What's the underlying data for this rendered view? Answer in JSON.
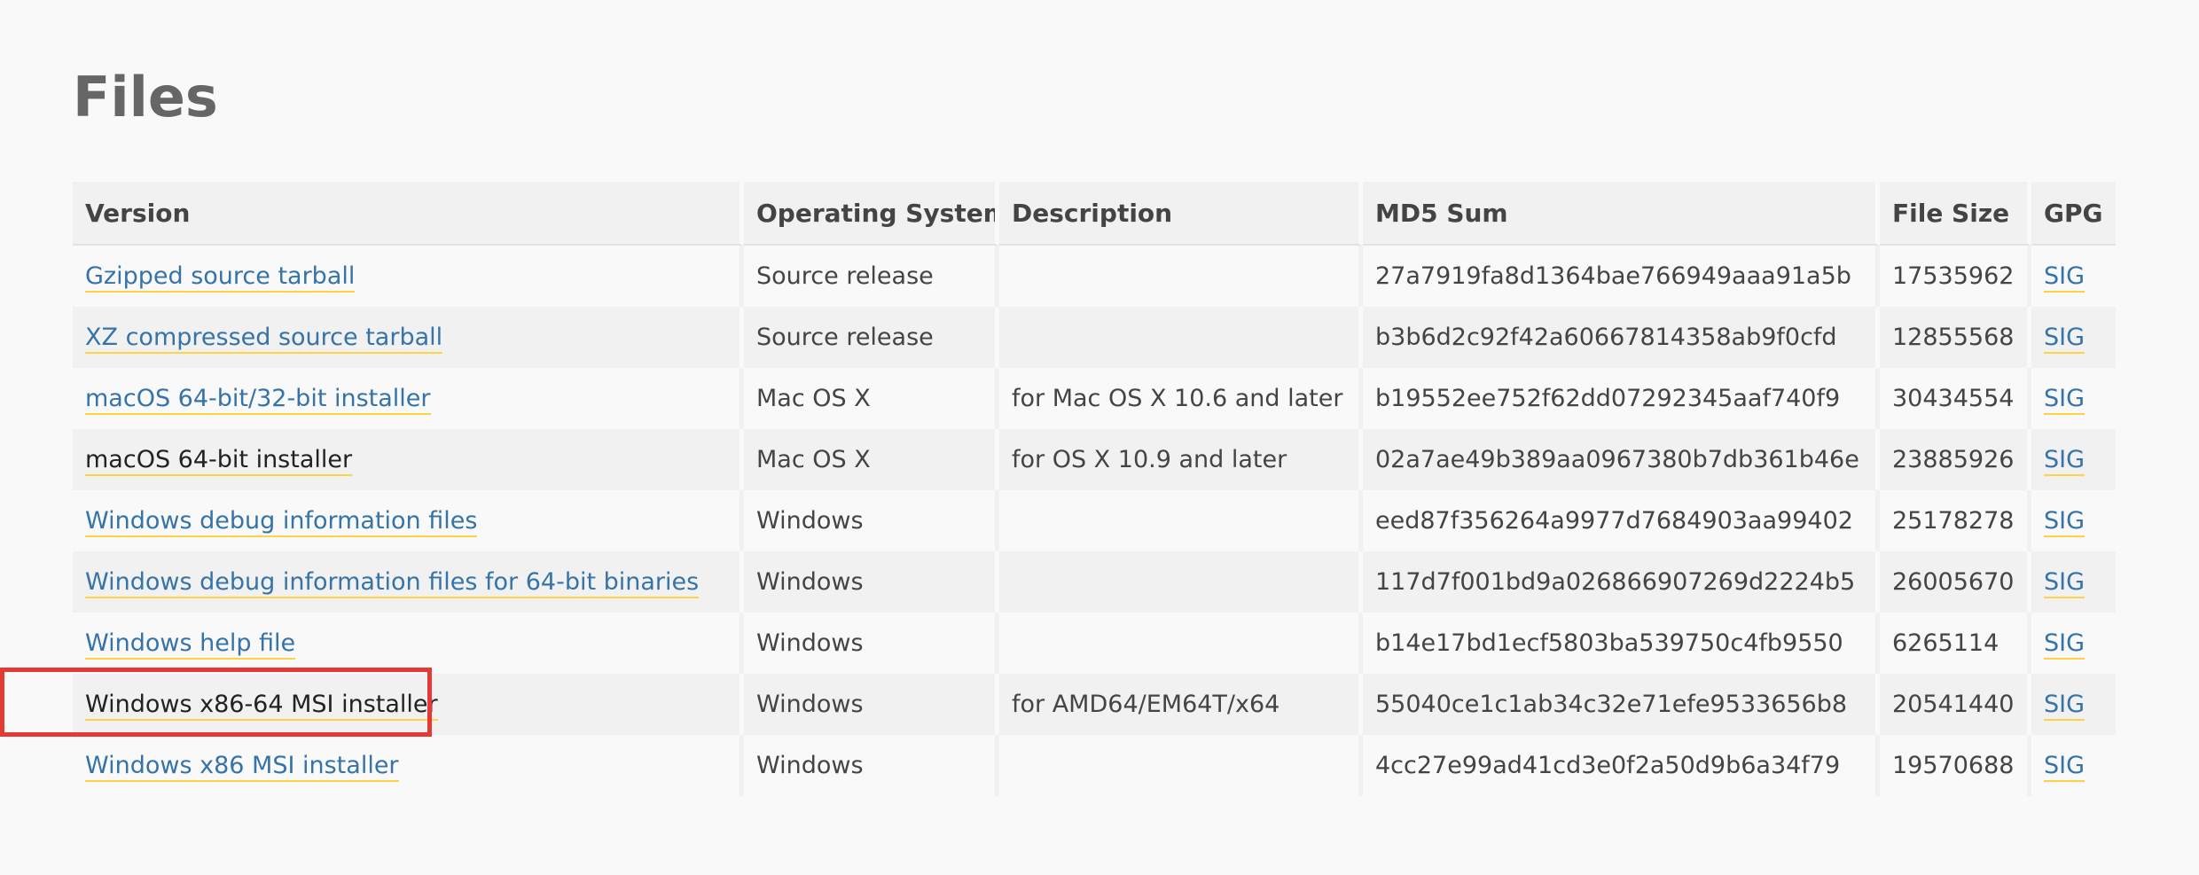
{
  "page": {
    "heading": "Files"
  },
  "table": {
    "headers": [
      "Version",
      "Operating System",
      "Description",
      "MD5 Sum",
      "File Size",
      "GPG"
    ],
    "rows": [
      {
        "version": "Gzipped source tarball",
        "visited": false,
        "os": "Source release",
        "description": "",
        "md5": "27a7919fa8d1364bae766949aaa91a5b",
        "size": "17535962",
        "gpg": "SIG"
      },
      {
        "version": "XZ compressed source tarball",
        "visited": false,
        "os": "Source release",
        "description": "",
        "md5": "b3b6d2c92f42a60667814358ab9f0cfd",
        "size": "12855568",
        "gpg": "SIG"
      },
      {
        "version": "macOS 64-bit/32-bit installer",
        "visited": false,
        "os": "Mac OS X",
        "description": "for Mac OS X 10.6 and later",
        "md5": "b19552ee752f62dd07292345aaf740f9",
        "size": "30434554",
        "gpg": "SIG"
      },
      {
        "version": "macOS 64-bit installer",
        "visited": true,
        "os": "Mac OS X",
        "description": "for OS X 10.9 and later",
        "md5": "02a7ae49b389aa0967380b7db361b46e",
        "size": "23885926",
        "gpg": "SIG"
      },
      {
        "version": "Windows debug information files",
        "visited": false,
        "os": "Windows",
        "description": "",
        "md5": "eed87f356264a9977d7684903aa99402",
        "size": "25178278",
        "gpg": "SIG"
      },
      {
        "version": "Windows debug information files for 64-bit binaries",
        "visited": false,
        "os": "Windows",
        "description": "",
        "md5": "117d7f001bd9a026866907269d2224b5",
        "size": "26005670",
        "gpg": "SIG"
      },
      {
        "version": "Windows help file",
        "visited": false,
        "os": "Windows",
        "description": "",
        "md5": "b14e17bd1ecf5803ba539750c4fb9550",
        "size": "6265114",
        "gpg": "SIG"
      },
      {
        "version": "Windows x86-64 MSI installer",
        "visited": true,
        "os": "Windows",
        "description": "for AMD64/EM64T/x64",
        "md5": "55040ce1c1ab34c32e71efe9533656b8",
        "size": "20541440",
        "gpg": "SIG"
      },
      {
        "version": "Windows x86 MSI installer",
        "visited": false,
        "os": "Windows",
        "description": "",
        "md5": "4cc27e99ad41cd3e0f2a50d9b6a34f79",
        "size": "19570688",
        "gpg": "SIG"
      }
    ]
  },
  "colors": {
    "link": "#3573a8",
    "link_underline": "#ffd343",
    "visited_link": "#222222",
    "highlight_box": "#e53935"
  }
}
